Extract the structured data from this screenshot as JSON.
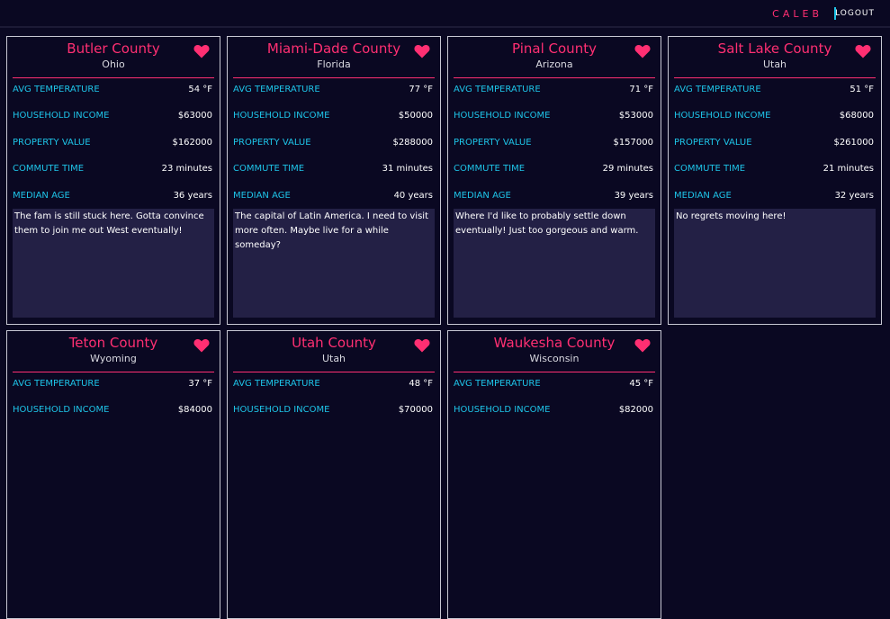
{
  "header": {
    "user": "CALEB",
    "logout": "LOGOUT"
  },
  "labels": {
    "avg_temp": "AVG TEMPERATURE",
    "income": "HOUSEHOLD INCOME",
    "property": "PROPERTY VALUE",
    "commute": "COMMUTE TIME",
    "age": "MEDIAN AGE"
  },
  "colors": {
    "accent": "#ff2f72",
    "label": "#1ec4e8",
    "background": "#0a0822",
    "note_bg": "#232045"
  },
  "cards": [
    {
      "county": "Butler County",
      "state": "Ohio",
      "avg_temp": "54 °F",
      "income": "$63000",
      "property": "$162000",
      "commute": "23 minutes",
      "age": "36 years",
      "note": "The fam is still stuck here. Gotta convince them to join me out West eventually!"
    },
    {
      "county": "Miami-Dade County",
      "state": "Florida",
      "avg_temp": "77 °F",
      "income": "$50000",
      "property": "$288000",
      "commute": "31 minutes",
      "age": "40 years",
      "note": "The capital of Latin America. I need to visit more often. Maybe live for a while someday?"
    },
    {
      "county": "Pinal County",
      "state": "Arizona",
      "avg_temp": "71 °F",
      "income": "$53000",
      "property": "$157000",
      "commute": "29 minutes",
      "age": "39 years",
      "note": "Where I'd like to probably settle down eventually! Just too gorgeous and warm."
    },
    {
      "county": "Salt Lake County",
      "state": "Utah",
      "avg_temp": "51 °F",
      "income": "$68000",
      "property": "$261000",
      "commute": "21 minutes",
      "age": "32 years",
      "note": "No regrets moving here!"
    },
    {
      "county": "Teton County",
      "state": "Wyoming",
      "avg_temp": "37 °F",
      "income": "$84000"
    },
    {
      "county": "Utah County",
      "state": "Utah",
      "avg_temp": "48 °F",
      "income": "$70000"
    },
    {
      "county": "Waukesha County",
      "state": "Wisconsin",
      "avg_temp": "45 °F",
      "income": "$82000"
    }
  ]
}
